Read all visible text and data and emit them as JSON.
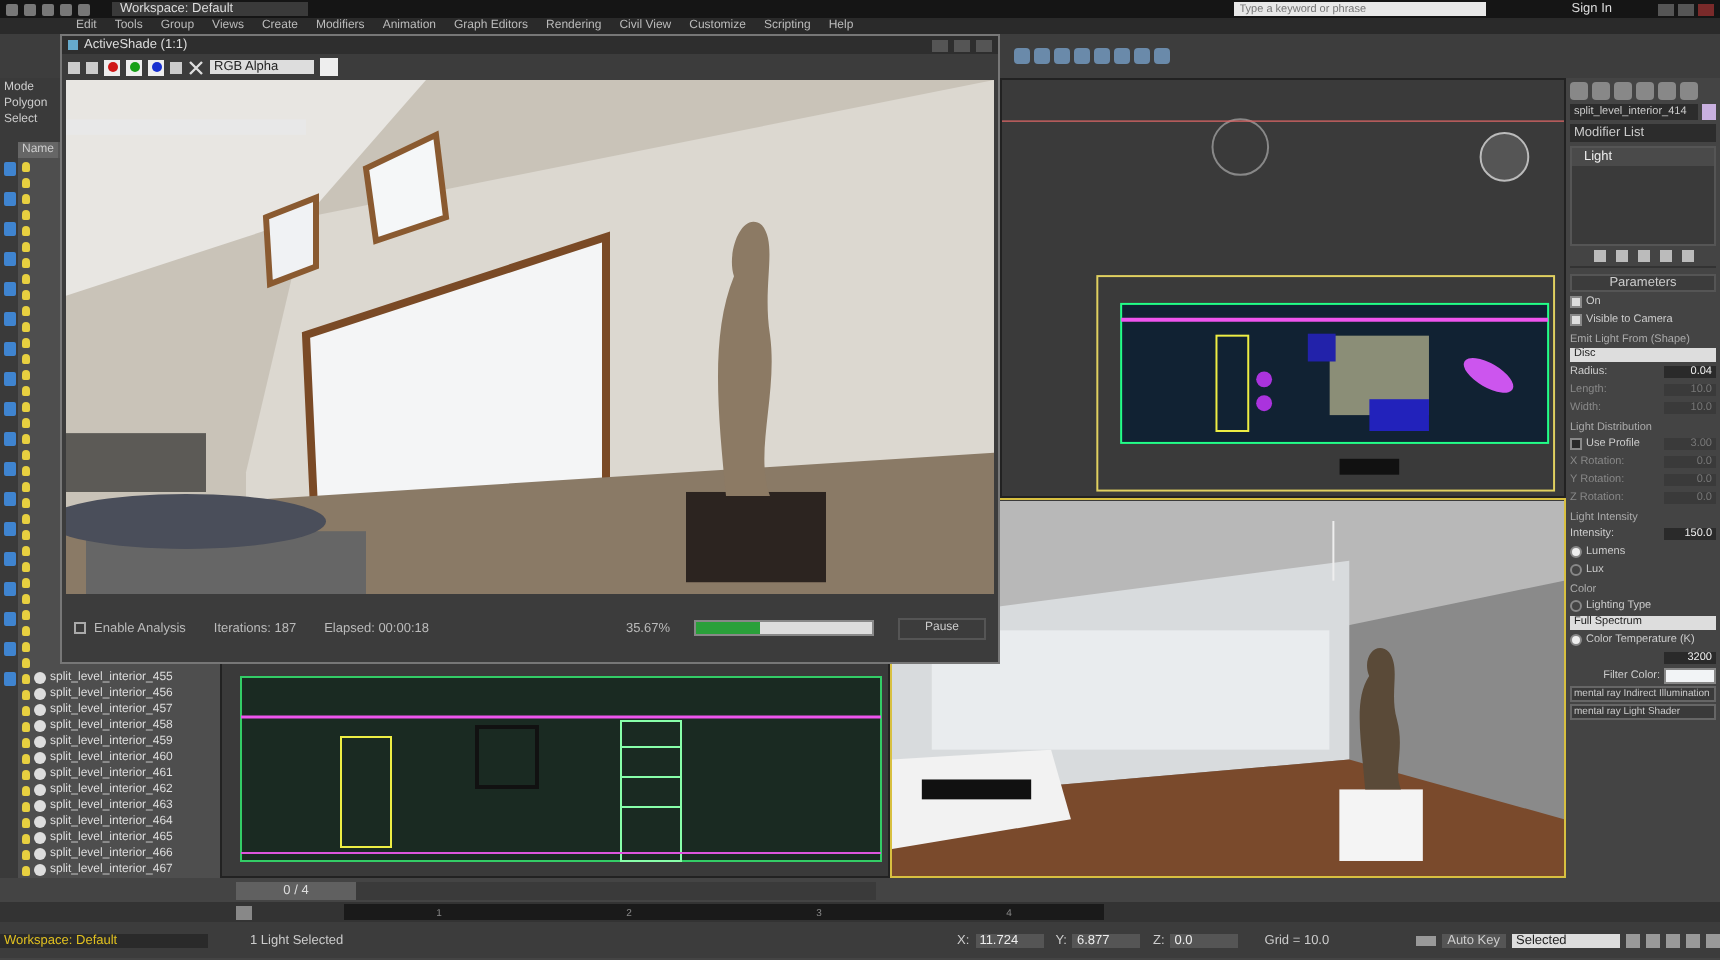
{
  "title_bar": {
    "workspace": "Workspace: Default",
    "search": {
      "placeholder": "Type a keyword or phrase"
    },
    "sign_in": "Sign In"
  },
  "menu": [
    "Edit",
    "Tools",
    "Group",
    "Views",
    "Create",
    "Modifiers",
    "Animation",
    "Graph Editors",
    "Rendering",
    "Civil View",
    "Customize",
    "Scripting",
    "Help"
  ],
  "ribbon": {
    "tabs": [
      "Mode",
      "Polygon",
      "Select"
    ]
  },
  "scene_explorer": {
    "header": "Name",
    "items": [
      "split_level_interior_455",
      "split_level_interior_456",
      "split_level_interior_457",
      "split_level_interior_458",
      "split_level_interior_459",
      "split_level_interior_460",
      "split_level_interior_461",
      "split_level_interior_462",
      "split_level_interior_463",
      "split_level_interior_464",
      "split_level_interior_465",
      "split_level_interior_466",
      "split_level_interior_467"
    ]
  },
  "activeshade": {
    "title": "ActiveShade (1:1)",
    "channels": [
      {
        "color": "#d01818"
      },
      {
        "color": "#18a018"
      },
      {
        "color": "#1830d0"
      }
    ],
    "channel_mode": "RGB Alpha",
    "enable_analysis": {
      "label": "Enable Analysis",
      "checked": false
    },
    "iterations": "Iterations: 187",
    "elapsed": "Elapsed: 00:00:18",
    "percent": "35.67%",
    "level": 0.36,
    "pause": "Pause"
  },
  "command_panel": {
    "object_name": "split_level_interior_414",
    "modifier_list": "Modifier List",
    "stack": [
      "Light"
    ],
    "rows": [
      {
        "kind": "header",
        "label": "Parameters"
      },
      {
        "kind": "checkbox",
        "label": "On",
        "checked": true
      },
      {
        "kind": "checkbox",
        "label": "Visible to Camera",
        "checked": true
      },
      {
        "kind": "group",
        "label": "Emit Light From (Shape)"
      },
      {
        "kind": "dropdown",
        "value": "Disc"
      },
      {
        "kind": "spinner",
        "label": "Radius:",
        "value": "0.04",
        "disabled": false
      },
      {
        "kind": "spinner",
        "label": "Length:",
        "value": "10.0",
        "disabled": true
      },
      {
        "kind": "spinner",
        "label": "Width:",
        "value": "10.0",
        "disabled": true
      },
      {
        "kind": "group",
        "label": "Light Distribution"
      },
      {
        "kind": "checkbox",
        "label": "Use Profile",
        "checked": false,
        "value": "3.00"
      },
      {
        "kind": "spinner",
        "label": "X Rotation:",
        "value": "0.0",
        "disabled": true
      },
      {
        "kind": "spinner",
        "label": "Y Rotation:",
        "value": "0.0",
        "disabled": true
      },
      {
        "kind": "spinner",
        "label": "Z Rotation:",
        "value": "0.0",
        "disabled": true
      },
      {
        "kind": "group",
        "label": "Light Intensity"
      },
      {
        "kind": "spinner",
        "label": "Intensity:",
        "value": "150.0",
        "disabled": false
      },
      {
        "kind": "radio",
        "label": "Lumens",
        "selected": true
      },
      {
        "kind": "radio",
        "label": "Lux",
        "selected": false
      },
      {
        "kind": "group",
        "label": "Color"
      },
      {
        "kind": "radio",
        "label": "Lighting Type",
        "selected": false
      },
      {
        "kind": "dropdown",
        "value": "Full Spectrum"
      },
      {
        "kind": "radio",
        "label": "Color Temperature (K)",
        "selected": true
      },
      {
        "kind": "spinner",
        "label": "",
        "value": "3200",
        "disabled": false
      },
      {
        "kind": "swatch",
        "label": "Filter Color:",
        "color": "#f2f4f6"
      },
      {
        "kind": "rollout",
        "label": "mental ray Indirect Illumination"
      },
      {
        "kind": "rollout",
        "label": "mental ray Light Shader"
      }
    ]
  },
  "timeline": {
    "frame": "0 / 4",
    "ticks": [
      "1",
      "2",
      "3",
      "4"
    ]
  },
  "status_bar": {
    "workspace": "Workspace: Default",
    "message": "1 Light Selected",
    "coords": [
      {
        "label": "X:",
        "value": "11.724"
      },
      {
        "label": "Y:",
        "value": "6.877"
      },
      {
        "label": "Z:",
        "value": "0.0"
      }
    ],
    "grid": "Grid = 10.0",
    "auto_key": "Auto Key",
    "key_mode": "Selected"
  }
}
